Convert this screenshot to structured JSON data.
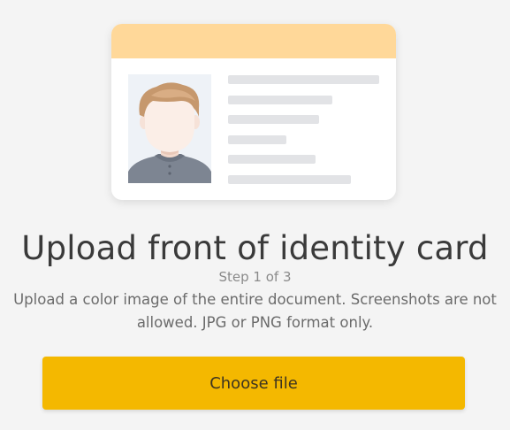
{
  "illustration": {
    "name": "identity-card-illustration",
    "header_color": "#ffd899",
    "avatar_icon": "person-portrait-icon"
  },
  "upload": {
    "title": "Upload front of identity card",
    "step": "Step 1 of 3",
    "description": "Upload a color image of the entire document. Screenshots are not allowed. JPG or PNG format only.",
    "button_label": "Choose file"
  },
  "colors": {
    "background": "#f4f4f4",
    "accent": "#f4b800",
    "card_header": "#ffd899"
  }
}
